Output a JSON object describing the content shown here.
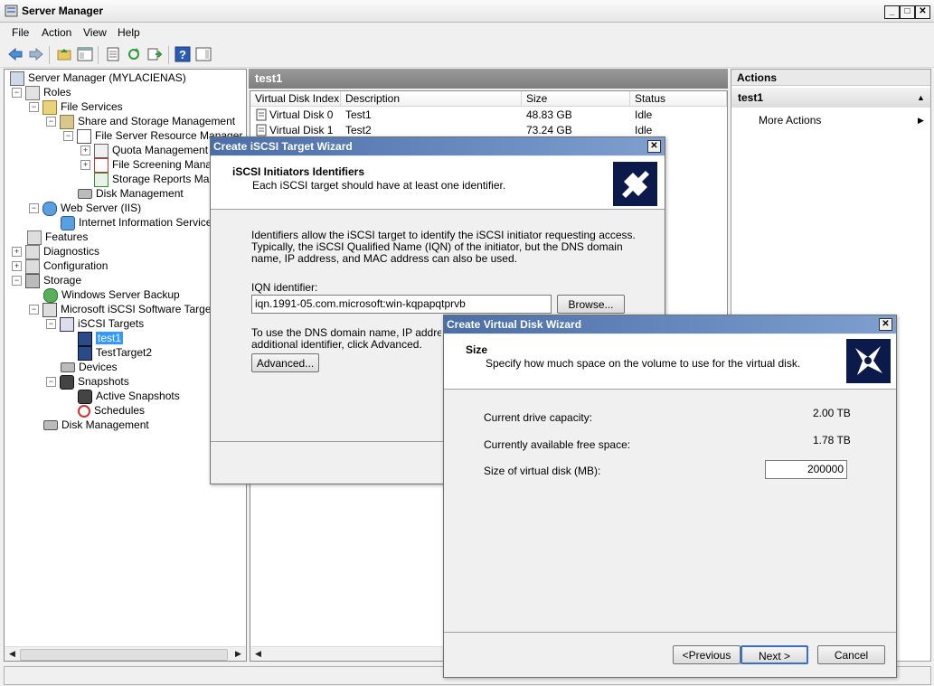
{
  "window": {
    "title": "Server Manager"
  },
  "menu": [
    "File",
    "Action",
    "View",
    "Help"
  ],
  "tree": {
    "items": [
      {
        "label": "Server Manager (MYLACIENAS)"
      },
      {
        "label": "Roles"
      },
      {
        "label": "File Services"
      },
      {
        "label": "Share and Storage Management"
      },
      {
        "label": "File Server Resource Manager"
      },
      {
        "label": "Quota Management"
      },
      {
        "label": "File Screening Manage"
      },
      {
        "label": "Storage Reports Mana"
      },
      {
        "label": "Disk Management"
      },
      {
        "label": "Web Server (IIS)"
      },
      {
        "label": "Internet Information Services"
      },
      {
        "label": "Features"
      },
      {
        "label": "Diagnostics"
      },
      {
        "label": "Configuration"
      },
      {
        "label": "Storage"
      },
      {
        "label": "Windows Server Backup"
      },
      {
        "label": "Microsoft iSCSI Software Target"
      },
      {
        "label": "iSCSI Targets"
      },
      {
        "label": "test1"
      },
      {
        "label": "TestTarget2"
      },
      {
        "label": "Devices"
      },
      {
        "label": "Snapshots"
      },
      {
        "label": "Active Snapshots"
      },
      {
        "label": "Schedules"
      },
      {
        "label": "Disk Management"
      }
    ]
  },
  "center": {
    "title": "test1",
    "columns": [
      "Virtual Disk Index",
      "Description",
      "Size",
      "Status"
    ],
    "rows": [
      [
        "Virtual Disk 0",
        "Test1",
        "48.83 GB",
        "Idle"
      ],
      [
        "Virtual Disk 1",
        "Test2",
        "73.24 GB",
        "Idle"
      ]
    ]
  },
  "actions": {
    "header": "Actions",
    "section": "test1",
    "item": "More Actions"
  },
  "iscsi_wizard": {
    "title": "Create iSCSI Target Wizard",
    "heading": "iSCSI Initiators Identifiers",
    "subheading": "Each iSCSI target should have at least one identifier.",
    "desc": "Identifiers allow the iSCSI target to identify the iSCSI initiator requesting access. Typically, the iSCSI Qualified Name (IQN) of the initiator, but the DNS domain name, IP address, and MAC address can also be used.",
    "iqn_label": "IQN identifier:",
    "iqn_value": "iqn.1991-05.com.microsoft:win-kqpapqtprvb",
    "browse": "Browse...",
    "dns_text_1": "To use the DNS domain name, IP address, M",
    "dns_text_2": "additional identifier, click Advanced.",
    "advanced": "Advanced..."
  },
  "vdisk_wizard": {
    "title": "Create Virtual Disk Wizard",
    "heading": "Size",
    "subheading": "Specify how much space on the volume to use for the virtual disk.",
    "capacity_label": "Current drive capacity:",
    "capacity_value": "2.00 TB",
    "free_label": "Currently available free space:",
    "free_value": "1.78 TB",
    "size_label": "Size of virtual disk (MB):",
    "size_value": "200000",
    "prev": "<Previous",
    "next": "Next >",
    "cancel": "Cancel"
  },
  "colors": {
    "selection": "#3399ff",
    "dialog_title": "#4b6ea8"
  }
}
